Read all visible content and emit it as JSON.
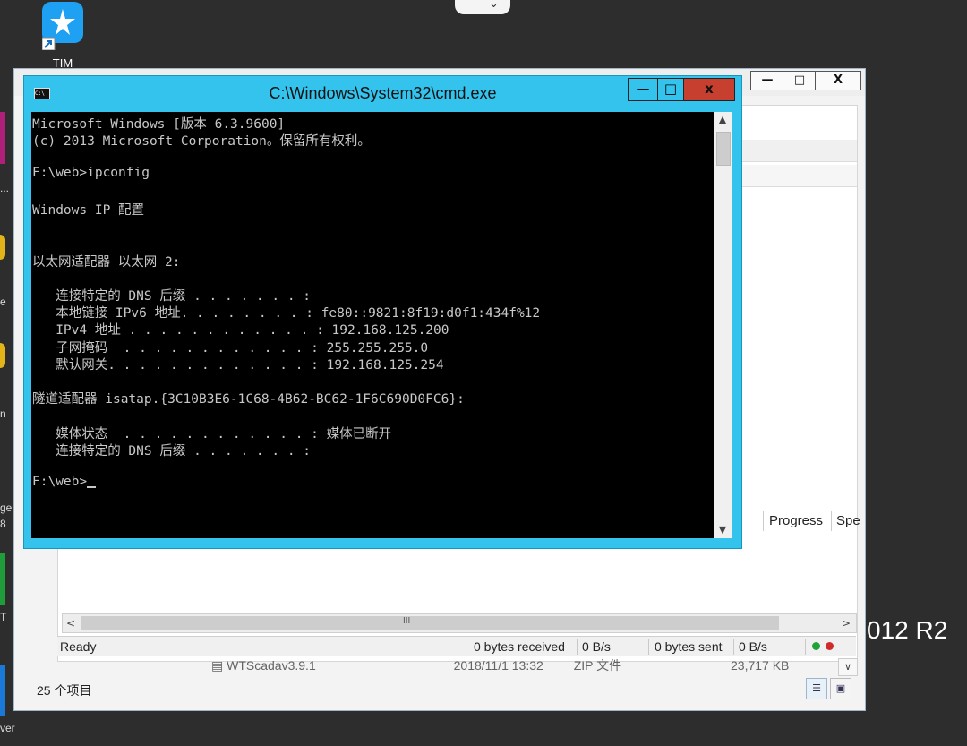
{
  "top_bar": {
    "minimize_glyph": "–",
    "chevron_glyph": "⌄"
  },
  "desktop": {
    "tim_label": "TIM",
    "r2_text": "012 R2",
    "left_strip_texts": [
      "...",
      "e",
      "n",
      "ge",
      "8",
      "T",
      "ver"
    ]
  },
  "explorer": {
    "window_buttons": {
      "minimize": "—",
      "maximize": "□",
      "close": "X"
    },
    "columns": {
      "progress": "Progress",
      "speed": "Spe"
    },
    "scroll_grip": "III",
    "status": {
      "ready": "Ready",
      "bytes_received": "0 bytes received",
      "recv_rate": "0 B/s",
      "bytes_sent": "0 bytes sent",
      "sent_rate": "0 B/s"
    },
    "file_row": {
      "name": "WTScadav3.9.1",
      "date": "2018/11/1 13:32",
      "type": "ZIP 文件",
      "size": "23,717 KB"
    },
    "item_count": "25 个项目",
    "colors": {
      "status_green": "#22a33a",
      "status_red": "#d02a2a"
    }
  },
  "cmd": {
    "title": "C:\\Windows\\System32\\cmd.exe",
    "icon_text": "C:\\",
    "buttons": {
      "minimize": "—",
      "maximize": "□",
      "close": "x"
    },
    "colors": {
      "frame": "#33c3ec",
      "close": "#c7402f",
      "text": "#c8c8c8"
    },
    "lines": [
      "Microsoft Windows [版本 6.3.9600]",
      "(c) 2013 Microsoft Corporation。保留所有权利。",
      "",
      "F:\\web>ipconfig",
      "",
      "Windows IP 配置",
      "",
      "",
      "以太网适配器 以太网 2:",
      "",
      "   连接特定的 DNS 后缀 . . . . . . . :",
      "   本地链接 IPv6 地址. . . . . . . . : fe80::9821:8f19:d0f1:434f%12",
      "   IPv4 地址 . . . . . . . . . . . . : 192.168.125.200",
      "   子网掩码  . . . . . . . . . . . . : 255.255.255.0",
      "   默认网关. . . . . . . . . . . . . : 192.168.125.254",
      "",
      "隧道适配器 isatap.{3C10B3E6-1C68-4B62-BC62-1F6C690D0FC6}:",
      "",
      "   媒体状态  . . . . . . . . . . . . : 媒体已断开",
      "   连接特定的 DNS 后缀 . . . . . . . :",
      "",
      "F:\\web>"
    ]
  }
}
